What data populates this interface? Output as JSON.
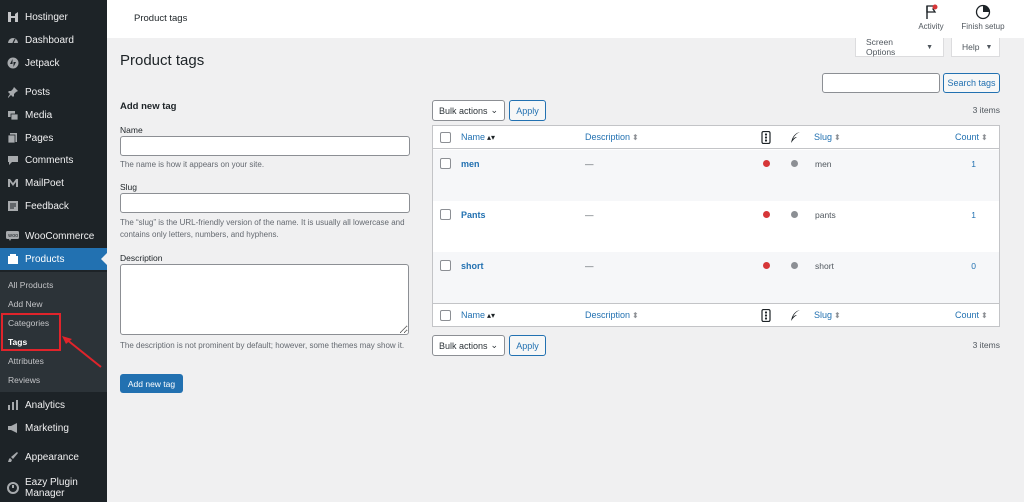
{
  "sidebar": {
    "items": [
      {
        "label": "Hostinger",
        "icon": "hostinger-icon"
      },
      {
        "label": "Dashboard",
        "icon": "dashboard-icon"
      },
      {
        "label": "Jetpack",
        "icon": "jetpack-icon"
      },
      {
        "label": "Posts",
        "icon": "pin-icon"
      },
      {
        "label": "Media",
        "icon": "media-icon"
      },
      {
        "label": "Pages",
        "icon": "pages-icon"
      },
      {
        "label": "Comments",
        "icon": "comments-icon"
      },
      {
        "label": "MailPoet",
        "icon": "mailpoet-icon"
      },
      {
        "label": "Feedback",
        "icon": "feedback-icon"
      },
      {
        "label": "WooCommerce",
        "icon": "woocommerce-icon"
      },
      {
        "label": "Products",
        "icon": "products-icon"
      },
      {
        "label": "Analytics",
        "icon": "analytics-icon"
      },
      {
        "label": "Marketing",
        "icon": "megaphone-icon"
      },
      {
        "label": "Appearance",
        "icon": "brush-icon"
      },
      {
        "label": "Eazy Plugin",
        "label2": "Manager",
        "icon": "plugin-manager-icon"
      }
    ],
    "submenu": [
      "All Products",
      "Add New",
      "Categories",
      "Tags",
      "Attributes",
      "Reviews"
    ]
  },
  "topbar": {
    "title": "Product tags",
    "activity_label": "Activity",
    "finish_setup_label": "Finish setup"
  },
  "screen_options": {
    "label": "Screen Options",
    "caret": "▼"
  },
  "help": {
    "label": "Help",
    "caret": "▼"
  },
  "page": {
    "title": "Product tags"
  },
  "search": {
    "placeholder": "",
    "button_label": "Search tags"
  },
  "form": {
    "heading": "Add new tag",
    "name_label": "Name",
    "name_help": "The name is how it appears on your site.",
    "slug_label": "Slug",
    "slug_help": "The “slug” is the URL-friendly version of the name. It is usually all lowercase and contains only letters, numbers, and hyphens.",
    "description_label": "Description",
    "description_help": "The description is not prominent by default; however, some themes may show it.",
    "submit_label": "Add new tag"
  },
  "bulk": {
    "select_label": "Bulk actions",
    "caret": "⌄",
    "apply_label": "Apply",
    "items_count": "3 items"
  },
  "table": {
    "columns": {
      "name": "Name",
      "description": "Description",
      "slug": "Slug",
      "count": "Count"
    },
    "sort_arrows": {
      "both": "⬍",
      "desc": "▴▾"
    },
    "rows": [
      {
        "name": "men",
        "description": "—",
        "slug": "men",
        "count": "1"
      },
      {
        "name": "Pants",
        "description": "—",
        "slug": "pants",
        "count": "1"
      },
      {
        "name": "short",
        "description": "—",
        "slug": "short",
        "count": "0"
      }
    ]
  },
  "colors": {
    "accent": "#2271b1",
    "sidebar_bg": "#1d2327",
    "highlight": "#e0242b",
    "dot_red": "#d63638",
    "dot_gray": "#8c8f94"
  }
}
